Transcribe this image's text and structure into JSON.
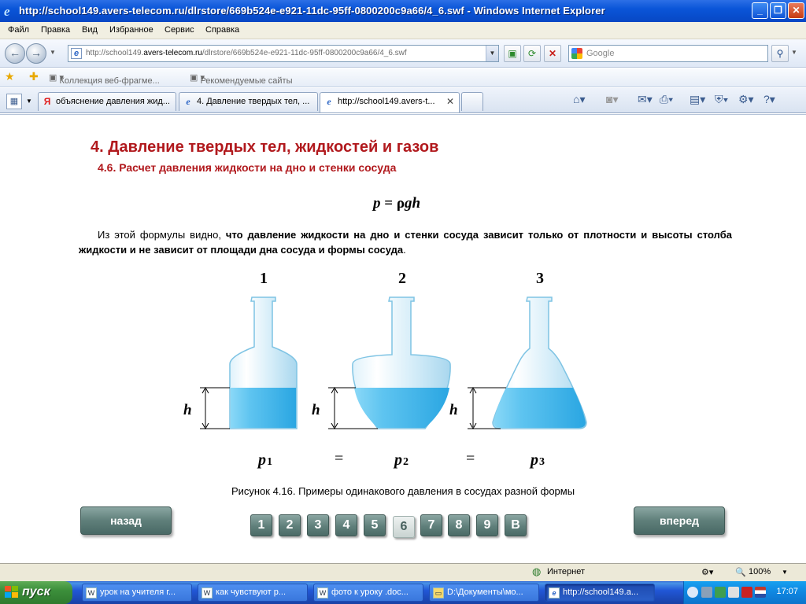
{
  "window": {
    "title": "http://school149.avers-telecom.ru/dlrstore/669b524e-e921-11dc-95ff-0800200c9a66/4_6.swf - Windows Internet Explorer"
  },
  "menu": [
    "Файл",
    "Правка",
    "Вид",
    "Избранное",
    "Сервис",
    "Справка"
  ],
  "address": {
    "url_prefix": "http://school149.",
    "url_host": "avers-telecom.ru",
    "url_rest": "/dlrstore/669b524e-e921-11dc-95ff-0800200c9a66/4_6.swf",
    "search_placeholder": "Google"
  },
  "favorites": {
    "gallery": "Коллекция веб-фрагме...",
    "suggested": "Рекомендуемые сайты"
  },
  "tabs": [
    {
      "label": "объяснение давления жид..."
    },
    {
      "label": "4. Давление твердых тел, ..."
    },
    {
      "label": "http://school149.avers-t..."
    }
  ],
  "page": {
    "title": "4. Давление твердых тел, жидкостей и газов",
    "subtitle": "4.6. Расчет давления жидкости на дно и стенки сосуда",
    "formula_p": "p",
    "formula_eq": " = ρ",
    "formula_gh": "gh",
    "para_start": "Из этой формулы видно, ",
    "para_bold": "что давление жидкости на дно и стенки сосуда зависит только от плотности и высоты столба жидкости и не зависит от площади дна сосуда и формы сосуда",
    "para_end": ".",
    "figure": {
      "vessel_numbers": [
        "1",
        "2",
        "3"
      ],
      "height_label": "h",
      "pressure_labels": [
        "p",
        "p",
        "p"
      ],
      "pressure_subs": [
        "1",
        "2",
        "3"
      ],
      "equals": "="
    },
    "caption": "Рисунок 4.16. Примеры одинакового давления в сосудах разной формы",
    "back_label": "назад",
    "forward_label": "вперед",
    "pages": [
      "1",
      "2",
      "3",
      "4",
      "5",
      "6",
      "7",
      "8",
      "9",
      "В"
    ],
    "current_page": "6"
  },
  "status": {
    "zone": "Интернет",
    "zoom": "100%"
  },
  "taskbar": {
    "start": "пуск",
    "items": [
      "урок на учителя г...",
      "как чувствуют р...",
      "фото к уроку .doc...",
      "D:\\Документы\\мо...",
      "http://school149.a..."
    ],
    "clock": "17:07"
  },
  "colors": {
    "heading": "#b1191d",
    "liquid": "#5ec4f0",
    "button": "#5f7f7a"
  }
}
